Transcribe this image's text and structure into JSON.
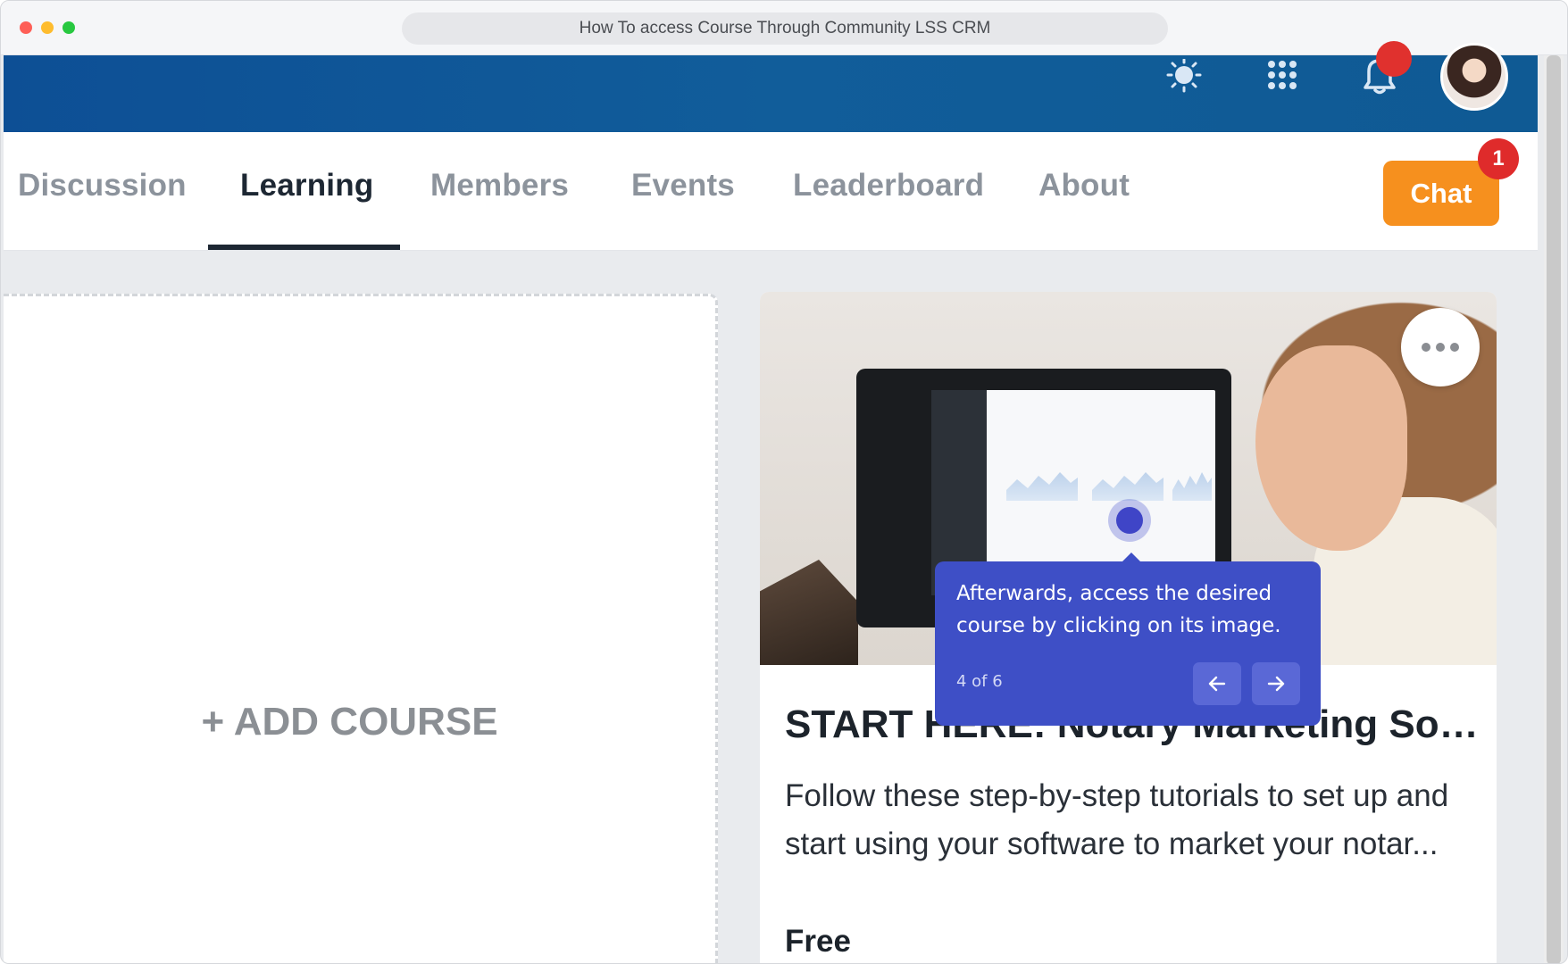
{
  "browser": {
    "title": "How To access Course Through Community LSS CRM"
  },
  "header": {
    "icons": [
      "sun-icon",
      "apps-grid-icon",
      "bell-icon",
      "avatar"
    ],
    "colors": {
      "bar": "#0f5a94",
      "badge": "#e0312e"
    }
  },
  "tabs": [
    {
      "label": "Discussion",
      "active": false
    },
    {
      "label": "Learning",
      "active": true
    },
    {
      "label": "Members",
      "active": false
    },
    {
      "label": "Events",
      "active": false
    },
    {
      "label": "Leaderboard",
      "active": false
    },
    {
      "label": "About",
      "active": false
    }
  ],
  "chat": {
    "label": "Chat",
    "badge": "1",
    "color": "#f6901e"
  },
  "add_course": {
    "label": "+ ADD COURSE"
  },
  "course": {
    "title": "START HERE: Notary Marketing Soft...",
    "description": "Follow these step-by-step tutorials to set up and start using your software to market your notar...",
    "price": "Free",
    "menu_icon": "more-dots-icon"
  },
  "tour": {
    "text": "Afterwards, access the desired course by clicking on its image.",
    "step": "4 of 6",
    "prev_icon": "arrow-left-icon",
    "next_icon": "arrow-right-icon",
    "color": "#3e4fc6"
  }
}
